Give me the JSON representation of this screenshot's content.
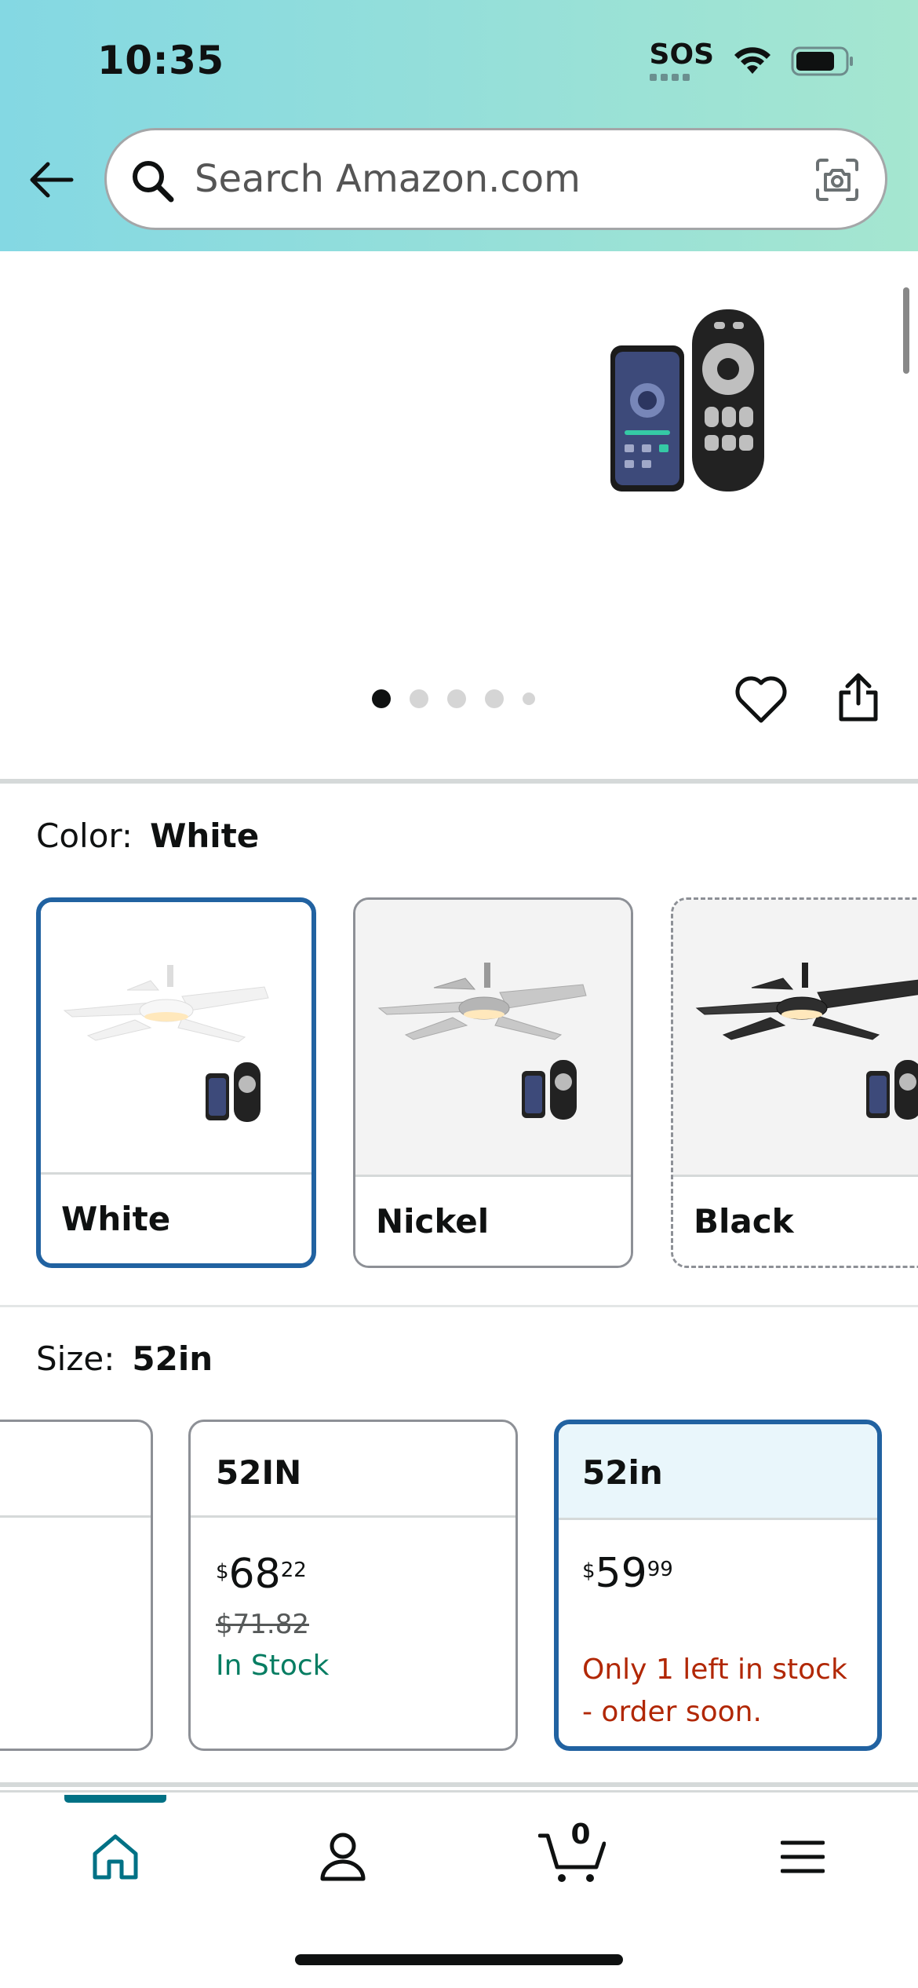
{
  "status_bar": {
    "time": "10:35",
    "sos": "SOS"
  },
  "search": {
    "placeholder": "Search Amazon.com"
  },
  "gallery": {
    "image_count": 5,
    "active_index": 0
  },
  "color": {
    "label": "Color:",
    "selected": "White",
    "options": [
      {
        "name": "White",
        "state": "selected"
      },
      {
        "name": "Nickel",
        "state": "available"
      },
      {
        "name": "Black",
        "state": "unavailable"
      }
    ]
  },
  "size": {
    "label": "Size:",
    "selected": "52in",
    "options": [
      {
        "name": "",
        "state": "available"
      },
      {
        "name": "52IN",
        "price_symbol": "$",
        "price_whole": "68",
        "price_fraction": "22",
        "list_price": "$71.82",
        "stock": "In Stock",
        "state": "available"
      },
      {
        "name": "52in",
        "price_symbol": "$",
        "price_whole": "59",
        "price_fraction": "99",
        "stock": "Only 1 left in stock - order soon.",
        "state": "selected"
      }
    ]
  },
  "tabbar": {
    "cart_count": "0",
    "active": "home"
  },
  "colors": {
    "selected_border": "#2162a1",
    "in_stock": "#067d62",
    "low_stock": "#b12704",
    "accent_tab": "#007185"
  }
}
